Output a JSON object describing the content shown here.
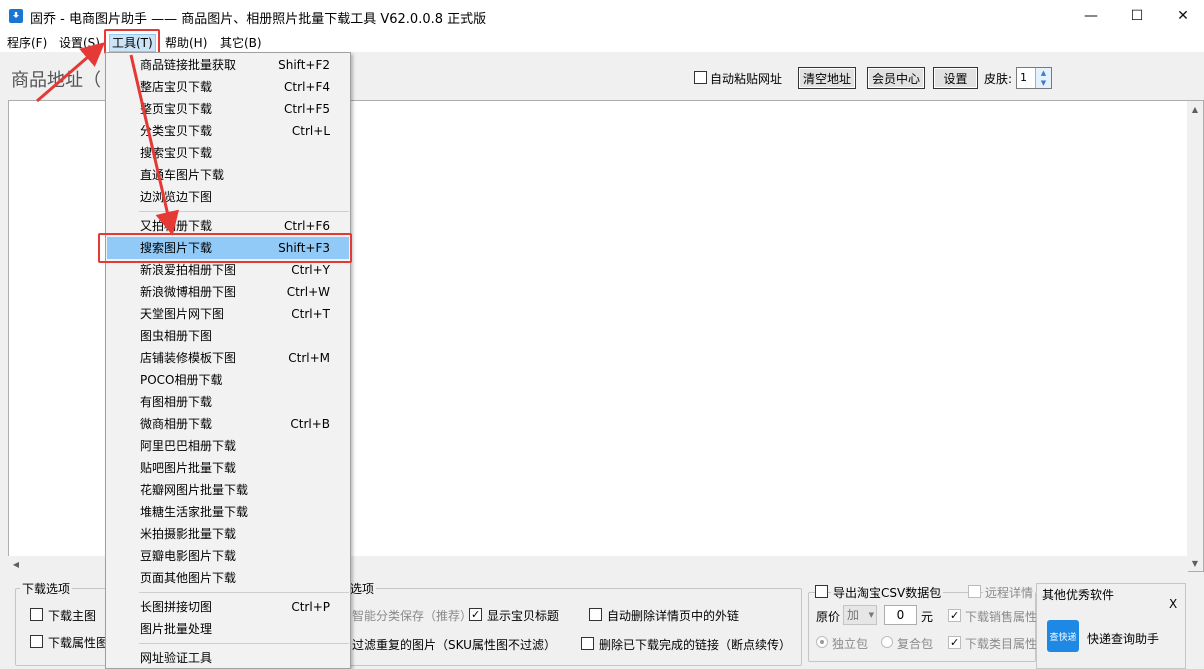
{
  "window": {
    "title": "固乔 - 电商图片助手 —— 商品图片、相册照片批量下载工具 V62.0.0.8 正式版",
    "minimize": "—",
    "maximize": "☐",
    "close": "✕"
  },
  "menubar": {
    "items": [
      "程序(F)",
      "设置(S)",
      "工具(T)",
      "帮助(H)",
      "其它(B)"
    ]
  },
  "toolbar": {
    "address_label": "商品地址（",
    "auto_paste": "自动粘贴网址",
    "clear_address": "清空地址",
    "member_center": "会员中心",
    "settings": "设置",
    "skin_label": "皮肤:",
    "skin_value": "1"
  },
  "tools_menu": {
    "groups": [
      [
        {
          "label": "商品链接批量获取",
          "shortcut": "Shift+F2"
        },
        {
          "label": "整店宝贝下载",
          "shortcut": "Ctrl+F4"
        },
        {
          "label": "整页宝贝下载",
          "shortcut": "Ctrl+F5"
        },
        {
          "label": "分类宝贝下载",
          "shortcut": "Ctrl+L"
        },
        {
          "label": "搜索宝贝下载",
          "shortcut": ""
        },
        {
          "label": "直通车图片下载",
          "shortcut": ""
        },
        {
          "label": "边浏览边下图",
          "shortcut": ""
        }
      ],
      [
        {
          "label": "又拍相册下载",
          "shortcut": "Ctrl+F6"
        },
        {
          "label": "搜索图片下载",
          "shortcut": "Shift+F3"
        },
        {
          "label": "新浪爱拍相册下图",
          "shortcut": "Ctrl+Y"
        },
        {
          "label": "新浪微博相册下图",
          "shortcut": "Ctrl+W"
        },
        {
          "label": "天堂图片网下图",
          "shortcut": "Ctrl+T"
        },
        {
          "label": "图虫相册下图",
          "shortcut": ""
        },
        {
          "label": "店铺装修模板下图",
          "shortcut": "Ctrl+M"
        },
        {
          "label": "POCO相册下载",
          "shortcut": ""
        },
        {
          "label": "有图相册下载",
          "shortcut": ""
        },
        {
          "label": "微商相册下载",
          "shortcut": "Ctrl+B"
        },
        {
          "label": "阿里巴巴相册下载",
          "shortcut": ""
        },
        {
          "label": "贴吧图片批量下载",
          "shortcut": ""
        },
        {
          "label": "花瓣网图片批量下载",
          "shortcut": ""
        },
        {
          "label": "堆糖生活家批量下载",
          "shortcut": ""
        },
        {
          "label": "米拍摄影批量下载",
          "shortcut": ""
        },
        {
          "label": "豆瓣电影图片下载",
          "shortcut": ""
        },
        {
          "label": "页面其他图片下载",
          "shortcut": ""
        }
      ],
      [
        {
          "label": "长图拼接切图",
          "shortcut": "Ctrl+P"
        },
        {
          "label": "图片批量处理",
          "shortcut": ""
        }
      ],
      [
        {
          "label": "网址验证工具",
          "shortcut": ""
        }
      ]
    ]
  },
  "download_options": {
    "title": "下载选项",
    "main_image": "下载主图",
    "attr_image": "下载属性图"
  },
  "other_options": {
    "title": "选项",
    "smart_classify": "智能分类保存（推荐）",
    "show_title": "显示宝贝标题",
    "filter_dup": "过滤重复的图片（SKU属性图不过滤）",
    "auto_delete_links": "自动删除详情页中的外链",
    "delete_done_links": "删除已下载完成的链接（断点续传）"
  },
  "csv_options": {
    "export_csv": "导出淘宝CSV数据包",
    "remote_detail": "远程详情",
    "price_label": "原价",
    "price_op": "加",
    "price_value": "0",
    "price_unit": "元",
    "sales_attr": "下载销售属性",
    "category_attr": "下载类目属性",
    "standalone": "独立包",
    "composite": "复合包"
  },
  "side_panel": {
    "title": "其他优秀软件",
    "close": "X",
    "app_name": "快递查询助手",
    "app_icon_text": "查快递"
  },
  "accent": {
    "highlight": "#91c9f7",
    "annotation_red": "#e53935"
  }
}
